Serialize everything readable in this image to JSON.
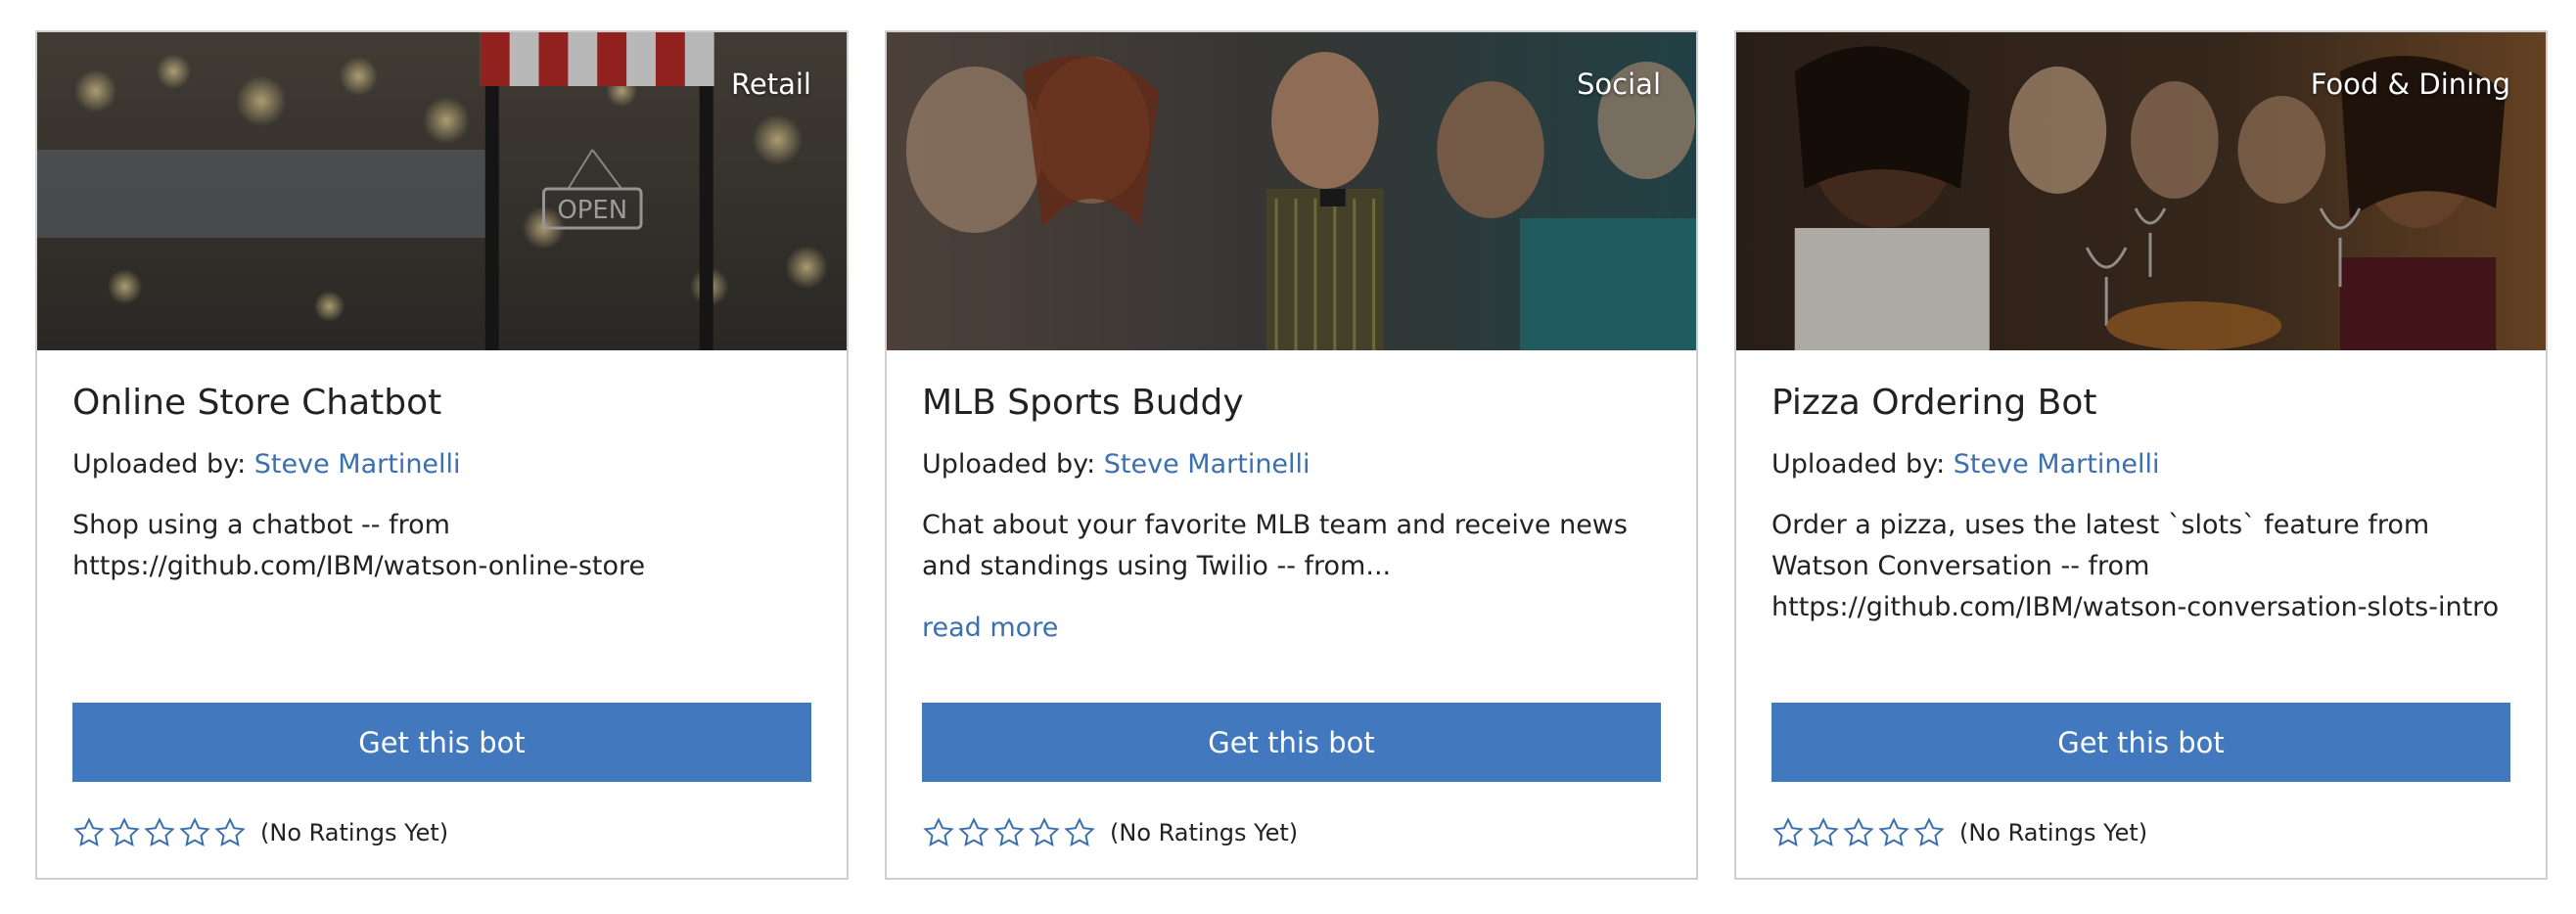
{
  "cards": [
    {
      "category": "Retail",
      "title": "Online Store Chatbot",
      "uploaded_label": "Uploaded by: ",
      "author": "Steve Martinelli",
      "description": "Shop using a chatbot -- from https://github.com/IBM/watson-online-store",
      "read_more": "",
      "button_label": "Get this bot",
      "rating_text": "(No Ratings Yet)",
      "rating_stars": 0
    },
    {
      "category": "Social",
      "title": "MLB Sports Buddy",
      "uploaded_label": "Uploaded by: ",
      "author": "Steve Martinelli",
      "description": "Chat about your favorite MLB team and receive news and standings using Twilio -- from...",
      "read_more": "read more",
      "button_label": "Get this bot",
      "rating_text": "(No Ratings Yet)",
      "rating_stars": 0
    },
    {
      "category": "Food & Dining",
      "title": "Pizza Ordering Bot",
      "uploaded_label": "Uploaded by: ",
      "author": "Steve Martinelli",
      "description": "Order a pizza, uses the latest `slots` feature from Watson Conversation -- from https://github.com/IBM/watson-conversation-slots-intro",
      "read_more": "",
      "button_label": "Get this bot",
      "rating_text": "(No Ratings Yet)",
      "rating_stars": 0
    }
  ],
  "colors": {
    "accent": "#4178be",
    "link": "#3a6fb0",
    "star_outline": "#3a6fb0",
    "card_border": "#cfcfcf"
  },
  "icons": {
    "star": "star-outline-icon"
  }
}
